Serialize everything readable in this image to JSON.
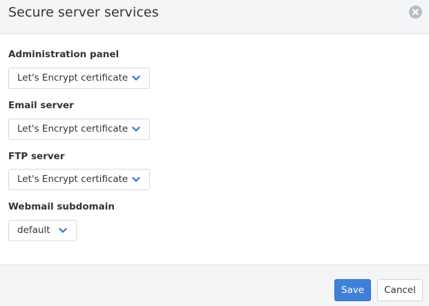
{
  "dialog": {
    "title": "Secure server services",
    "close_icon": "close-icon"
  },
  "fields": [
    {
      "label": "Administration panel",
      "value": "Let's Encrypt certificate"
    },
    {
      "label": "Email server",
      "value": "Let's Encrypt certificate"
    },
    {
      "label": "FTP server",
      "value": "Let's Encrypt certificate"
    },
    {
      "label": "Webmail subdomain",
      "value": "default"
    }
  ],
  "footer": {
    "save_label": "Save",
    "cancel_label": "Cancel"
  },
  "colors": {
    "accent": "#3e7fd8",
    "header_bg": "#f4f5f7",
    "chevron": "#3e7fd8"
  }
}
